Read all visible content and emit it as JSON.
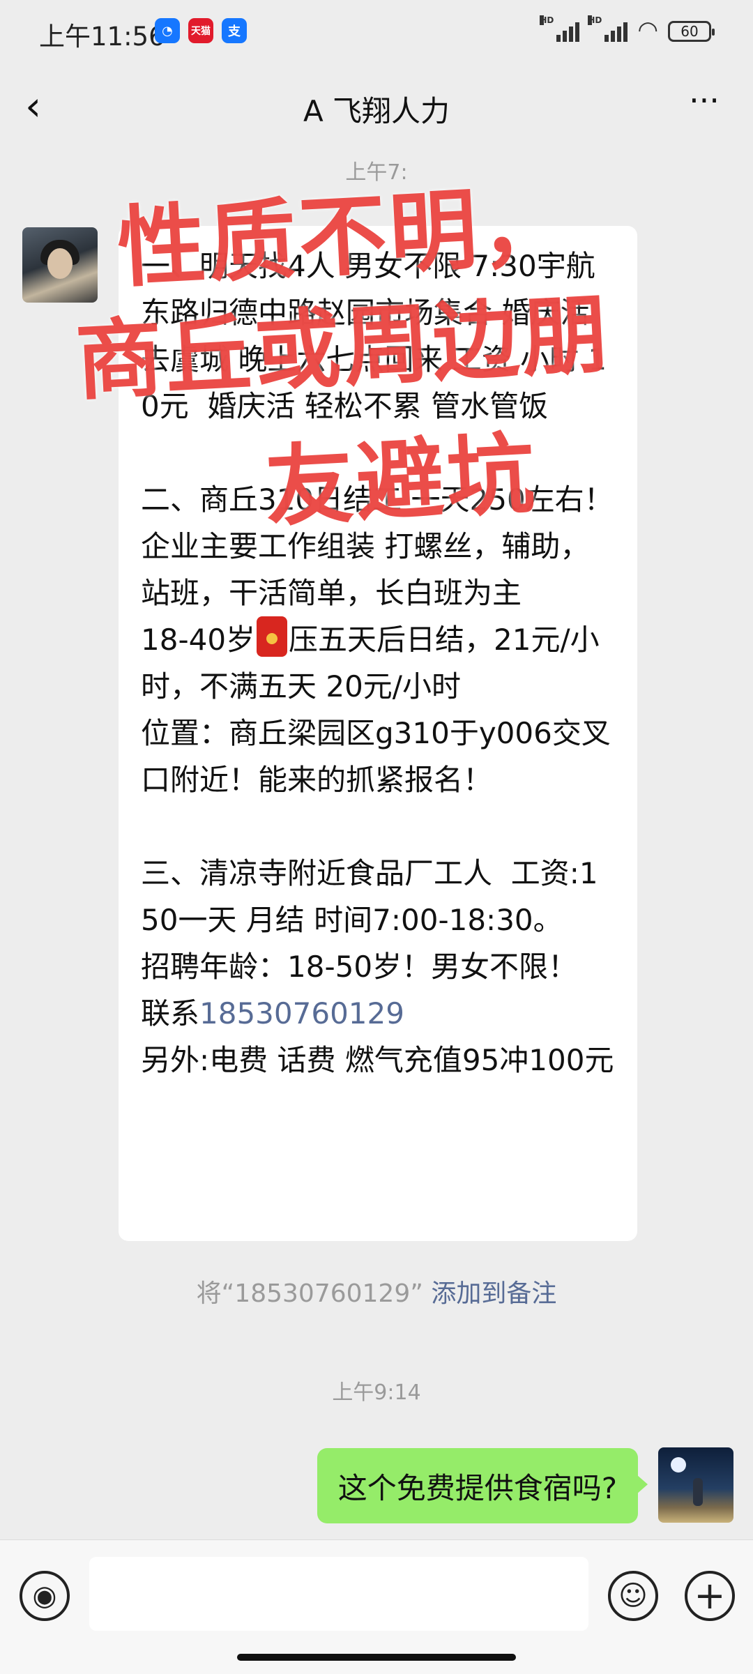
{
  "status_bar": {
    "time": "上午11:56",
    "app_icons": [
      "baidu-netdisk-icon",
      "tmall-icon",
      "alipay-icon"
    ],
    "app_icon_glyphs": [
      "◔",
      "天猫",
      "支"
    ],
    "signal_label": "HD",
    "battery": "60"
  },
  "nav": {
    "back_glyph": "‹",
    "title": "A 飞翔人力",
    "more_glyph": "···"
  },
  "chat": {
    "timestamp_top": "上午7:",
    "incoming_message": {
      "part1": "一、明天找4人 男女不限 7:30宇航东路归德中路赵园市场集合 婚庆活 去虞城 晚上六七点回来 工资 小时 10元  婚庆活 轻松不累 管水管饭\n\n二、商丘310日结工 一天250左右！\n企业主要工作组装 打螺丝，辅助，站班，干活简单，长白班为主\n18-40岁",
      "part2": "压五天后日结，21元/小时，不满五天 20元/小时\n位置：商丘梁园区g310于y006交叉口附近！能来的抓紧报名！\n\n三、清凉寺附近食品厂工人  工资:150一天 月结 时间7:00-18:30。\n招聘年龄：18-50岁！男女不限！\n联系",
      "phone": "18530760129",
      "part3": "\n另外:电费 话费 燃气充值95冲100元"
    },
    "add_note": {
      "prefix": "将“18530760129”",
      "link": "添加到备注"
    },
    "timestamp_2": "上午9:14",
    "outgoing_message": "这个免费提供食宿吗?"
  },
  "overlay": {
    "line1": "性质不明，",
    "line2": "商丘或周边朋",
    "line3": "友避坑"
  },
  "input_bar": {
    "voice_glyph": "◉",
    "emoji_glyph": "☺",
    "plus_glyph": "+"
  },
  "colors": {
    "background": "#ededed",
    "incoming_bubble": "#ffffff",
    "outgoing_bubble": "#95ec69",
    "link": "#576b95",
    "warning_text": "#e83430"
  }
}
